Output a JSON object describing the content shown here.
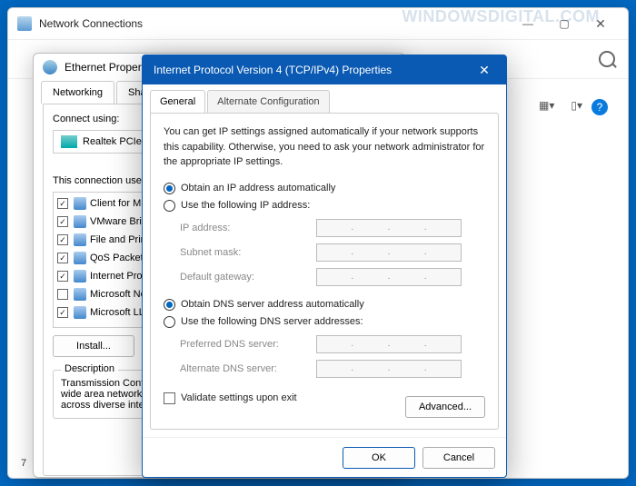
{
  "bg": {
    "title": "Network Connections",
    "item_count": "7"
  },
  "mid": {
    "title": "Ethernet Properties",
    "tabs": [
      "Networking",
      "Sharing"
    ],
    "connect_label": "Connect using:",
    "adapter": "Realtek PCIe G",
    "items_label": "This connection uses",
    "items": [
      {
        "checked": true,
        "label": "Client for Mic"
      },
      {
        "checked": true,
        "label": "VMware Brid"
      },
      {
        "checked": true,
        "label": "File and Print"
      },
      {
        "checked": true,
        "label": "QoS Packet"
      },
      {
        "checked": true,
        "label": "Internet Prot"
      },
      {
        "checked": false,
        "label": "Microsoft Ne"
      },
      {
        "checked": true,
        "label": "Microsoft LLI"
      }
    ],
    "install_btn": "Install...",
    "desc_label": "Description",
    "desc_text": "Transmission Contro\nwide area network\nacross diverse inter"
  },
  "dlg": {
    "title": "Internet Protocol Version 4 (TCP/IPv4) Properties",
    "tabs": {
      "general": "General",
      "alt": "Alternate Configuration"
    },
    "desc": "You can get IP settings assigned automatically if your network supports this capability. Otherwise, you need to ask your network administrator for the appropriate IP settings.",
    "ip": {
      "auto": "Obtain an IP address automatically",
      "manual": "Use the following IP address:",
      "fields": {
        "address": "IP address:",
        "subnet": "Subnet mask:",
        "gateway": "Default gateway:"
      }
    },
    "dns": {
      "auto": "Obtain DNS server address automatically",
      "manual": "Use the following DNS server addresses:",
      "fields": {
        "preferred": "Preferred DNS server:",
        "alternate": "Alternate DNS server:"
      }
    },
    "validate": "Validate settings upon exit",
    "advanced": "Advanced...",
    "ok": "OK",
    "cancel": "Cancel"
  },
  "watermark": "WINDOWSDIGITAL.COM"
}
